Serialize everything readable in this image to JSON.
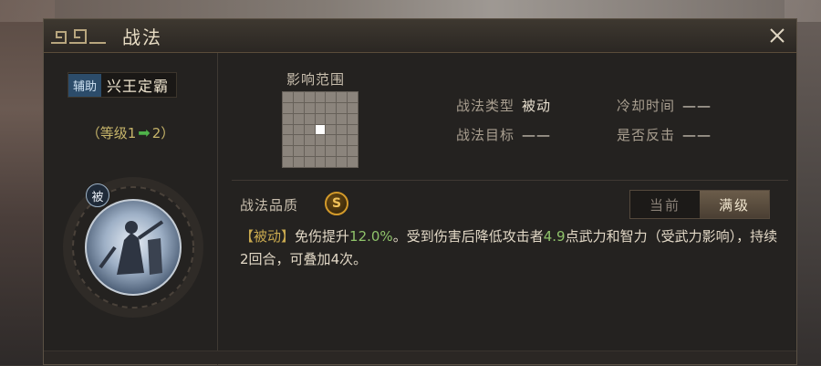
{
  "window": {
    "title": "战法"
  },
  "hero": {
    "role_tag": "辅助",
    "name": "兴王定霸",
    "level_prefix": "（等级1",
    "level_suffix": "2）",
    "passive_badge": "被"
  },
  "range": {
    "label": "影响范围",
    "grid_size": 7,
    "center_highlighted": true
  },
  "info": {
    "type_label": "战法类型",
    "type_value": "被动",
    "cooldown_label": "冷却时间",
    "cooldown_value": "——",
    "target_label": "战法目标",
    "target_value": "——",
    "counter_label": "是否反击",
    "counter_value": "——"
  },
  "quality": {
    "label": "战法品质",
    "grade": "S"
  },
  "toggle": {
    "current_label": "当前",
    "max_label": "满级",
    "selected": "max"
  },
  "description": {
    "tag": "【被动】",
    "part1": "免伤提升",
    "value1": "12.0%",
    "part2": "。受到伤害后降低攻击者",
    "value2": "4.9",
    "part3": "点武力和智力（受武力影响），持续",
    "value3": "2",
    "part4": "回合，可叠加",
    "value4": "4",
    "part5": "次。"
  },
  "colors": {
    "accent_gold": "#c9a94f",
    "value_green": "#8fc36a",
    "role_blue": "#2c4c6a"
  },
  "icons": {
    "close": "close-icon",
    "arrow": "arrow-right-icon",
    "grade": "quality-s-icon"
  }
}
